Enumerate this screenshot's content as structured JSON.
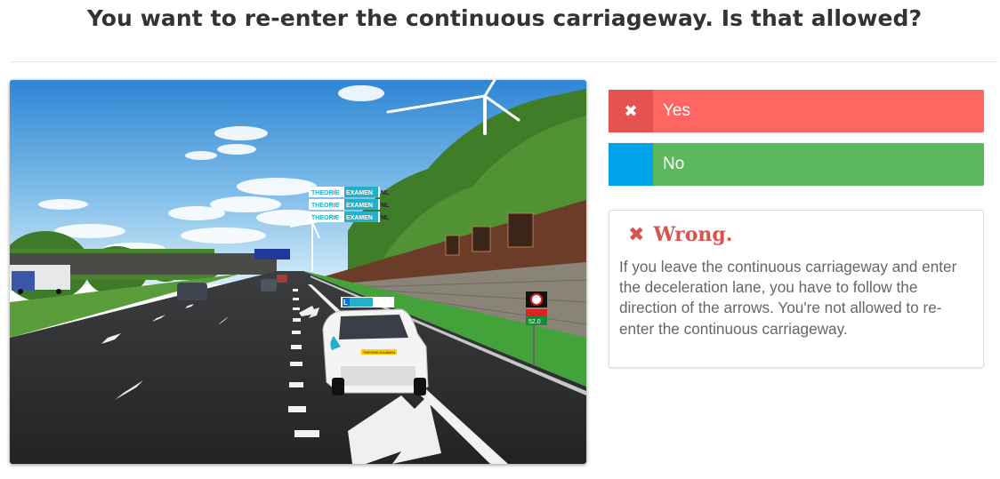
{
  "question": {
    "title": "You want to re-enter the continuous carriageway. Is that allowed?"
  },
  "scene": {
    "signboard": [
      "THEORIE",
      "EXAMEN",
      "NL"
    ],
    "car_plate": "THEORIE-EXAMEN",
    "road_sign_value": "52.0"
  },
  "answers": [
    {
      "label": "Yes",
      "mark_icon": "times-icon",
      "mark_glyph": "✖",
      "selected": true,
      "correct": false,
      "color": "#ff6662"
    },
    {
      "label": "No",
      "mark_icon": "blank",
      "mark_glyph": "",
      "selected": false,
      "correct": true,
      "color": "#5cb85c"
    }
  ],
  "feedback": {
    "icon": "times-icon",
    "icon_glyph": "✖",
    "heading": "Wrong.",
    "text": "If you leave the continuous carriageway and enter the deceleration lane, you have to follow the direction of the arrows. You're not allowed to re-enter the continuous carriageway.",
    "color": "#d9534f"
  }
}
